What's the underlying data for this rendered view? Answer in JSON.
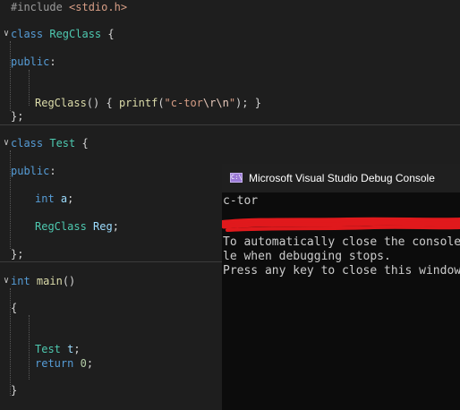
{
  "editor": {
    "include": {
      "directive": "#include",
      "header": "<stdio.h>"
    },
    "reg_class": {
      "keyword": "class",
      "name": "RegClass",
      "open_brace": "{",
      "access": "public",
      "colon": ":",
      "ctor_name": "RegClass",
      "ctor_parens": "()",
      "ctor_open": "{",
      "call": "printf",
      "call_open": "(",
      "str_text": "\"c-tor",
      "esc1": "\\r",
      "esc2": "\\n",
      "str_close": "\"",
      "call_close": ");",
      "ctor_close": "}",
      "close_brace": "};"
    },
    "test_class": {
      "keyword": "class",
      "name": "Test",
      "open_brace": "{",
      "access": "public",
      "colon": ":",
      "member1_type": "int",
      "member1_name": "a",
      "semi": ";",
      "member2_type": "RegClass",
      "member2_name": "Reg",
      "close_brace": "};"
    },
    "main_fn": {
      "return_type": "int",
      "name": "main",
      "parens": "()",
      "open_brace": "{",
      "decl_type": "Test",
      "decl_name": "t",
      "semi": ";",
      "return_kw": "return",
      "return_val": "0",
      "close_brace": "}"
    },
    "fold_markers": [
      "∨",
      "∨",
      "∨"
    ]
  },
  "console": {
    "title": "Microsoft Visual Studio Debug Console",
    "icon_label": "C:\\",
    "lines": [
      "c-tor",
      "To automatically close the console when debugging stops, enab",
      "le when debugging stops.",
      "Press any key to close this window . . ."
    ],
    "redaction_color": "#e0191c"
  }
}
